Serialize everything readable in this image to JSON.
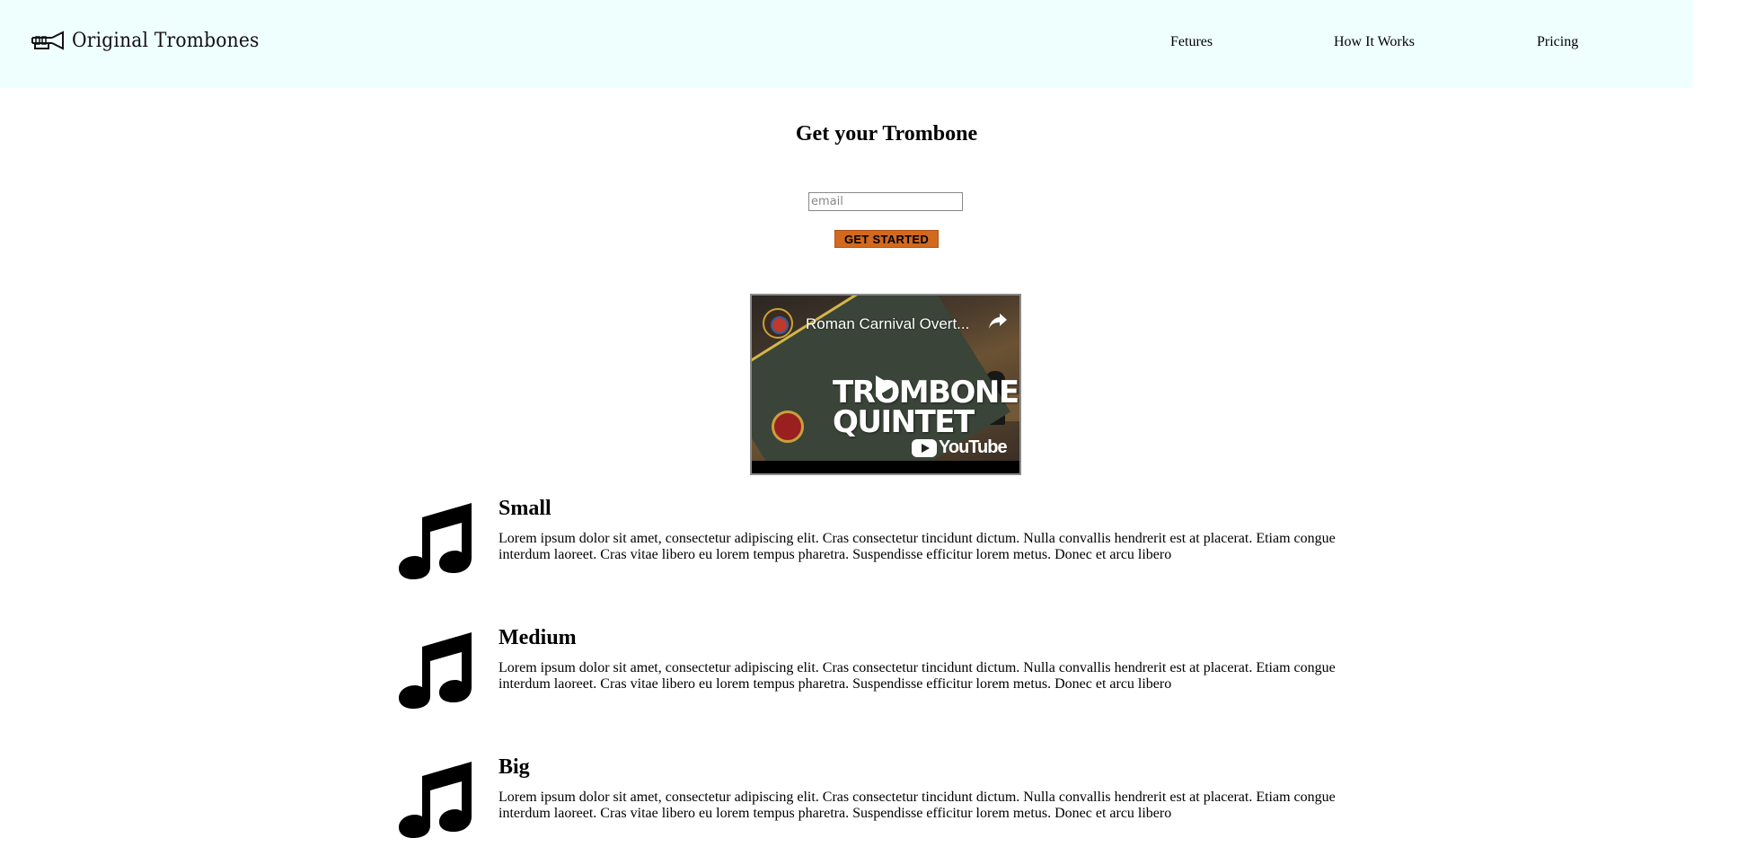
{
  "header": {
    "brand": "Original Trombones",
    "nav": [
      {
        "label": "Fetures"
      },
      {
        "label": "How It Works"
      },
      {
        "label": "Pricing"
      }
    ]
  },
  "hero": {
    "title": "Get your Trombone",
    "email_placeholder": "email",
    "cta_label": "GET STARTED"
  },
  "video": {
    "title": "Roman Carnival Overt...",
    "overlay_text_line1": "TROMBONE",
    "overlay_text_line2": "QUINTET",
    "platform": "YouTube"
  },
  "features": [
    {
      "icon": "music-note-icon",
      "title": "Small",
      "description": "Lorem ipsum dolor sit amet, consectetur adipiscing elit. Cras consectetur tincidunt dictum. Nulla convallis hendrerit est at placerat. Etiam congue interdum laoreet. Cras vitae libero eu lorem tempus pharetra. Suspendisse efficitur lorem metus. Donec et arcu libero"
    },
    {
      "icon": "music-note-icon",
      "title": "Medium",
      "description": "Lorem ipsum dolor sit amet, consectetur adipiscing elit. Cras consectetur tincidunt dictum. Nulla convallis hendrerit est at placerat. Etiam congue interdum laoreet. Cras vitae libero eu lorem tempus pharetra. Suspendisse efficitur lorem metus. Donec et arcu libero"
    },
    {
      "icon": "music-note-icon",
      "title": "Big",
      "description": "Lorem ipsum dolor sit amet, consectetur adipiscing elit. Cras consectetur tincidunt dictum. Nulla convallis hendrerit est at placerat. Etiam congue interdum laoreet. Cras vitae libero eu lorem tempus pharetra. Suspendisse efficitur lorem metus. Donec et arcu libero"
    }
  ],
  "colors": {
    "header_bg": "#effffe",
    "cta_bg": "#d2691e",
    "text": "#000000"
  }
}
